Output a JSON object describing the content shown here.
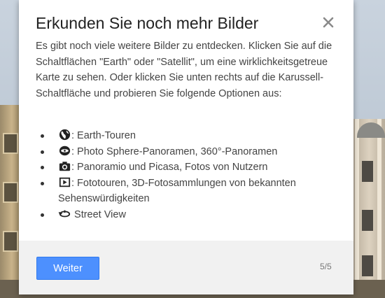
{
  "dialog": {
    "title": "Erkunden Sie noch mehr Bilder",
    "intro": "Es gibt noch viele weitere Bilder zu entdecken. Klicken Sie auf die Schaltflächen \"Earth\" oder \"Satellit\", um eine wirklichkeitsgetreue Karte zu sehen. Oder klicken Sie unten rechts auf die Karussell-Schaltfläche und probieren Sie folgende Optionen aus:",
    "features": [
      {
        "icon": "globe-icon",
        "label": ": Earth-Touren"
      },
      {
        "icon": "photo-sphere-icon",
        "label": ": Photo Sphere-Panoramen, 360°-Panoramen"
      },
      {
        "icon": "camera-icon",
        "label": ": Panoramio und Picasa, Fotos von Nutzern"
      },
      {
        "icon": "photo-tour-icon",
        "label_line1": ": Fototouren, 3D-Fotosammlungen von bekannten",
        "label_line2": "Sehenswürdigkeiten"
      },
      {
        "icon": "street-view-icon",
        "label": " Street View"
      }
    ],
    "button_label": "Weiter",
    "page_counter": "5/5"
  },
  "colors": {
    "button": "#4d90fe",
    "footer": "#f1f1f1"
  }
}
